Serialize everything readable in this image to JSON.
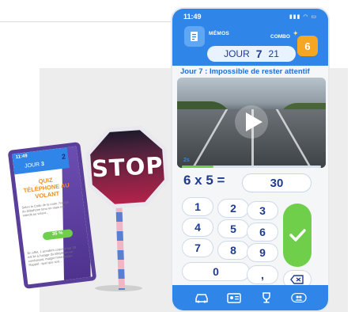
{
  "small_phone": {
    "time": "11:49",
    "day_label": "JOUR",
    "day_num": "3",
    "right_num": "2",
    "title": "QUIZ TÉLÉPHONE AU VOLANT",
    "body": "Selon le Code de la route, l'usage du téléphone tenu en main est interdit au volant...",
    "progress_label": "35 %",
    "progress": 0.35,
    "body2": "En effet, 1 accident corporel sur 10 est lié à l'usage du téléphone en conduisant, malgré l'interdiction. Rappel : quel que soit..."
  },
  "sign": {
    "text": "STOP"
  },
  "phone": {
    "status_time": "11:49",
    "status_icons": "▮▮▮ ◠ ▭",
    "memos_label": "MÉMOS",
    "combo_label": "COMBO",
    "combo_value": "6",
    "day_prefix": "JOUR",
    "day_current": "7",
    "day_total": "21",
    "day_title": "Jour 7 : Impossible de rester attentif",
    "timer_label": "2s",
    "timer_progress": 0.23,
    "question": "6 x 5 =",
    "answer": "30",
    "keys": [
      "1",
      "2",
      "3",
      "4",
      "5",
      "6",
      "7",
      "8",
      "9",
      "0",
      ","
    ],
    "backspace_icon": "backspace-icon",
    "submit_icon": "check-icon",
    "nav_icons": [
      "car-icon",
      "id-card-icon",
      "trophy-icon",
      "users-icon"
    ]
  },
  "colors": {
    "primary_blue": "#2f86e8",
    "navy": "#1f3b8f",
    "green": "#6fcf4b",
    "orange": "#f5a623",
    "stop_red": "#9b1b3d"
  }
}
